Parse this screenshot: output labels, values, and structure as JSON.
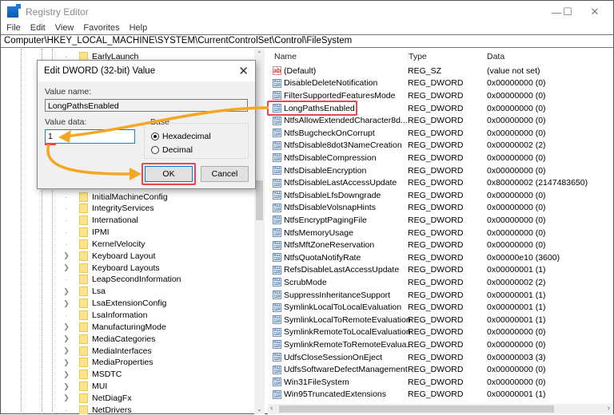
{
  "window": {
    "title": "Registry Editor",
    "controls": [
      "minimize",
      "maximize",
      "close"
    ]
  },
  "menu": [
    "File",
    "Edit",
    "View",
    "Favorites",
    "Help"
  ],
  "address": "Computer\\HKEY_LOCAL_MACHINE\\SYSTEM\\CurrentControlSet\\Control\\FileSystem",
  "tree": [
    {
      "label": "EarlyLaunch",
      "expandable": false
    },
    {
      "label": "InitialMachineConfig",
      "expandable": false
    },
    {
      "label": "IntegrityServices",
      "expandable": false
    },
    {
      "label": "International",
      "expandable": false
    },
    {
      "label": "IPMI",
      "expandable": false
    },
    {
      "label": "KernelVelocity",
      "expandable": false
    },
    {
      "label": "Keyboard Layout",
      "expandable": true
    },
    {
      "label": "Keyboard Layouts",
      "expandable": true
    },
    {
      "label": "LeapSecondInformation",
      "expandable": false
    },
    {
      "label": "Lsa",
      "expandable": true
    },
    {
      "label": "LsaExtensionConfig",
      "expandable": true
    },
    {
      "label": "LsaInformation",
      "expandable": false
    },
    {
      "label": "ManufacturingMode",
      "expandable": true
    },
    {
      "label": "MediaCategories",
      "expandable": true
    },
    {
      "label": "MediaInterfaces",
      "expandable": true
    },
    {
      "label": "MediaProperties",
      "expandable": true
    },
    {
      "label": "MSDTC",
      "expandable": true
    },
    {
      "label": "MUI",
      "expandable": true
    },
    {
      "label": "NetDiagFx",
      "expandable": true
    },
    {
      "label": "NetDrivers",
      "expandable": false
    }
  ],
  "list": {
    "columns": [
      "Name",
      "Type",
      "Data"
    ],
    "rows": [
      {
        "name": "(Default)",
        "type": "REG_SZ",
        "data": "(value not set)",
        "icon": "string-value-icon"
      },
      {
        "name": "DisableDeleteNotification",
        "type": "REG_DWORD",
        "data": "0x00000000 (0)"
      },
      {
        "name": "FilterSupportedFeaturesMode",
        "type": "REG_DWORD",
        "data": "0x00000000 (0)"
      },
      {
        "name": "LongPathsEnabled",
        "type": "REG_DWORD",
        "data": "0x00000000 (0)",
        "highlighted": true
      },
      {
        "name": "NtfsAllowExtendedCharacter8d...",
        "type": "REG_DWORD",
        "data": "0x00000000 (0)"
      },
      {
        "name": "NtfsBugcheckOnCorrupt",
        "type": "REG_DWORD",
        "data": "0x00000000 (0)"
      },
      {
        "name": "NtfsDisable8dot3NameCreation",
        "type": "REG_DWORD",
        "data": "0x00000002 (2)"
      },
      {
        "name": "NtfsDisableCompression",
        "type": "REG_DWORD",
        "data": "0x00000000 (0)"
      },
      {
        "name": "NtfsDisableEncryption",
        "type": "REG_DWORD",
        "data": "0x00000000 (0)"
      },
      {
        "name": "NtfsDisableLastAccessUpdate",
        "type": "REG_DWORD",
        "data": "0x80000002 (2147483650)"
      },
      {
        "name": "NtfsDisableLfsDowngrade",
        "type": "REG_DWORD",
        "data": "0x00000000 (0)"
      },
      {
        "name": "NtfsDisableVolsnapHints",
        "type": "REG_DWORD",
        "data": "0x00000000 (0)"
      },
      {
        "name": "NtfsEncryptPagingFile",
        "type": "REG_DWORD",
        "data": "0x00000000 (0)"
      },
      {
        "name": "NtfsMemoryUsage",
        "type": "REG_DWORD",
        "data": "0x00000000 (0)"
      },
      {
        "name": "NtfsMftZoneReservation",
        "type": "REG_DWORD",
        "data": "0x00000000 (0)"
      },
      {
        "name": "NtfsQuotaNotifyRate",
        "type": "REG_DWORD",
        "data": "0x00000e10 (3600)"
      },
      {
        "name": "RefsDisableLastAccessUpdate",
        "type": "REG_DWORD",
        "data": "0x00000001 (1)"
      },
      {
        "name": "ScrubMode",
        "type": "REG_DWORD",
        "data": "0x00000002 (2)"
      },
      {
        "name": "SuppressInheritanceSupport",
        "type": "REG_DWORD",
        "data": "0x00000001 (1)"
      },
      {
        "name": "SymlinkLocalToLocalEvaluation",
        "type": "REG_DWORD",
        "data": "0x00000001 (1)"
      },
      {
        "name": "SymlinkLocalToRemoteEvaluation",
        "type": "REG_DWORD",
        "data": "0x00000001 (1)"
      },
      {
        "name": "SymlinkRemoteToLocalEvaluation",
        "type": "REG_DWORD",
        "data": "0x00000000 (0)"
      },
      {
        "name": "SymlinkRemoteToRemoteEvalua...",
        "type": "REG_DWORD",
        "data": "0x00000000 (0)"
      },
      {
        "name": "UdfsCloseSessionOnEject",
        "type": "REG_DWORD",
        "data": "0x00000003 (3)"
      },
      {
        "name": "UdfsSoftwareDefectManagement",
        "type": "REG_DWORD",
        "data": "0x00000000 (0)"
      },
      {
        "name": "Win31FileSystem",
        "type": "REG_DWORD",
        "data": "0x00000000 (0)"
      },
      {
        "name": "Win95TruncatedExtensions",
        "type": "REG_DWORD",
        "data": "0x00000001 (1)"
      }
    ]
  },
  "dialog": {
    "title": "Edit DWORD (32-bit) Value",
    "value_name_label": "Value name:",
    "value_name": "LongPathsEnabled",
    "value_data_label": "Value data:",
    "value_data": "1",
    "base_label": "Base",
    "base_options": [
      {
        "label": "Hexadecimal",
        "selected": true
      },
      {
        "label": "Decimal",
        "selected": false
      }
    ],
    "ok": "OK",
    "cancel": "Cancel"
  },
  "annotation_colors": {
    "arrow": "#f5a623",
    "highlight": "#e8474f"
  }
}
